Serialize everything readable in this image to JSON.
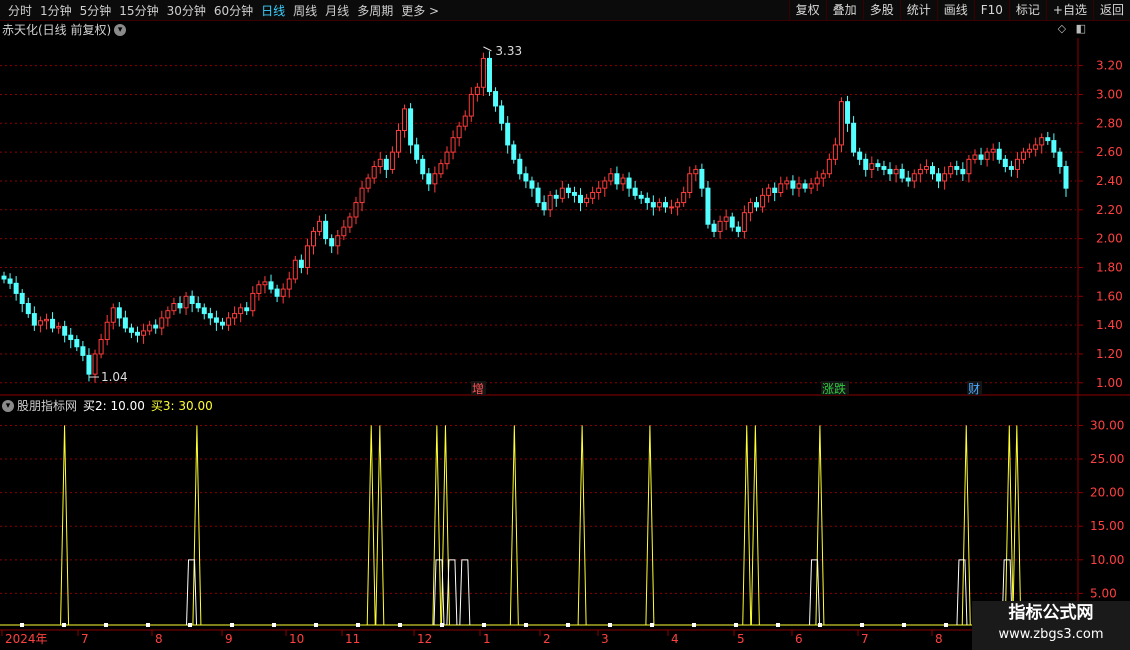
{
  "toolbar": {
    "timeframes": [
      "分时",
      "1分钟",
      "5分钟",
      "15分钟",
      "30分钟",
      "60分钟",
      "日线",
      "周线",
      "月线",
      "多周期",
      "更多"
    ],
    "active": "日线",
    "buttons": [
      "复权",
      "叠加",
      "多股",
      "统计",
      "画线",
      "F10",
      "标记",
      "+自选",
      "返回"
    ]
  },
  "main_title": "赤天化(日线 前复权)",
  "indicator_title": {
    "name": "股朋指标网",
    "buy2": "买2: 10.00",
    "buy3": "买3: 30.00"
  },
  "watermark": {
    "line1": "指标公式网",
    "line2": "www.zbgs3.com"
  },
  "chart_data": [
    {
      "type": "candlestick",
      "title": "赤天化(日线 前复权)",
      "ylim": [
        0.95,
        3.35
      ],
      "yticks": [
        1.0,
        1.2,
        1.4,
        1.6,
        1.8,
        2.0,
        2.2,
        2.4,
        2.6,
        2.8,
        3.0,
        3.2
      ],
      "ytick_labels": [
        "1.00",
        "1.20",
        "1.40",
        "1.60",
        "1.80",
        "2.00",
        "2.20",
        "2.40",
        "2.60",
        "2.80",
        "3.00",
        "3.20"
      ],
      "closes": [
        1.72,
        1.69,
        1.62,
        1.55,
        1.48,
        1.4,
        1.43,
        1.44,
        1.38,
        1.39,
        1.33,
        1.3,
        1.25,
        1.19,
        1.06,
        1.2,
        1.3,
        1.42,
        1.52,
        1.45,
        1.38,
        1.35,
        1.33,
        1.36,
        1.4,
        1.38,
        1.45,
        1.5,
        1.55,
        1.52,
        1.6,
        1.55,
        1.52,
        1.48,
        1.45,
        1.42,
        1.4,
        1.45,
        1.48,
        1.52,
        1.5,
        1.62,
        1.68,
        1.7,
        1.65,
        1.6,
        1.65,
        1.72,
        1.85,
        1.8,
        1.95,
        2.05,
        2.12,
        2.0,
        1.95,
        2.02,
        2.08,
        2.15,
        2.25,
        2.35,
        2.42,
        2.5,
        2.55,
        2.48,
        2.6,
        2.75,
        2.9,
        2.65,
        2.55,
        2.45,
        2.38,
        2.45,
        2.52,
        2.6,
        2.7,
        2.78,
        2.85,
        3.0,
        3.05,
        3.25,
        3.02,
        2.92,
        2.8,
        2.65,
        2.55,
        2.45,
        2.4,
        2.35,
        2.25,
        2.2,
        2.3,
        2.28,
        2.35,
        2.32,
        2.3,
        2.25,
        2.28,
        2.32,
        2.35,
        2.4,
        2.45,
        2.38,
        2.42,
        2.35,
        2.3,
        2.28,
        2.25,
        2.22,
        2.25,
        2.22,
        2.22,
        2.25,
        2.32,
        2.45,
        2.48,
        2.35,
        2.1,
        2.05,
        2.12,
        2.15,
        2.08,
        2.05,
        2.18,
        2.25,
        2.22,
        2.3,
        2.35,
        2.32,
        2.38,
        2.4,
        2.35,
        2.38,
        2.35,
        2.38,
        2.42,
        2.45,
        2.55,
        2.65,
        2.95,
        2.8,
        2.6,
        2.55,
        2.48,
        2.52,
        2.5,
        2.48,
        2.45,
        2.48,
        2.42,
        2.4,
        2.45,
        2.48,
        2.5,
        2.45,
        2.4,
        2.45,
        2.5,
        2.48,
        2.45,
        2.55,
        2.58,
        2.55,
        2.6,
        2.62,
        2.55,
        2.5,
        2.48,
        2.55,
        2.6,
        2.62,
        2.65,
        2.7,
        2.68,
        2.6,
        2.5,
        2.35
      ],
      "annotations": [
        {
          "label": "3.33",
          "type": "high"
        },
        {
          "label": "1.04",
          "type": "low"
        }
      ],
      "event_labels": [
        "增",
        "涨跌",
        "财"
      ]
    },
    {
      "type": "line",
      "title": "股朋指标网",
      "ylim": [
        0,
        32
      ],
      "yticks": [
        5,
        10,
        15,
        20,
        25,
        30
      ],
      "ytick_labels": [
        "5.00",
        "10.00",
        "15.00",
        "20.00",
        "25.00",
        "30.00"
      ],
      "series": [
        {
          "name": "买2",
          "value": 10.0,
          "color": "#ffffff"
        },
        {
          "name": "买3",
          "value": 30.0,
          "color": "#ffff33"
        }
      ],
      "buy3_spikes_x_fraction": [
        0.06,
        0.183,
        0.345,
        0.353,
        0.406,
        0.414,
        0.478,
        0.541,
        0.604,
        0.694,
        0.702,
        0.762,
        0.898,
        0.938,
        0.945
      ],
      "buy2_pulses_x_fraction": [
        0.178,
        0.408,
        0.42,
        0.432,
        0.757,
        0.894,
        0.936
      ],
      "x_labels": [
        "2024年",
        "7",
        "8",
        "9",
        "10",
        "11",
        "12",
        "1",
        "2",
        "3",
        "4",
        "5",
        "6",
        "7",
        "8"
      ]
    }
  ],
  "colors": {
    "up": "#ff3c3c",
    "down": "#54ffff",
    "grid": "#8b0000",
    "axis_text": "#ff4040"
  }
}
